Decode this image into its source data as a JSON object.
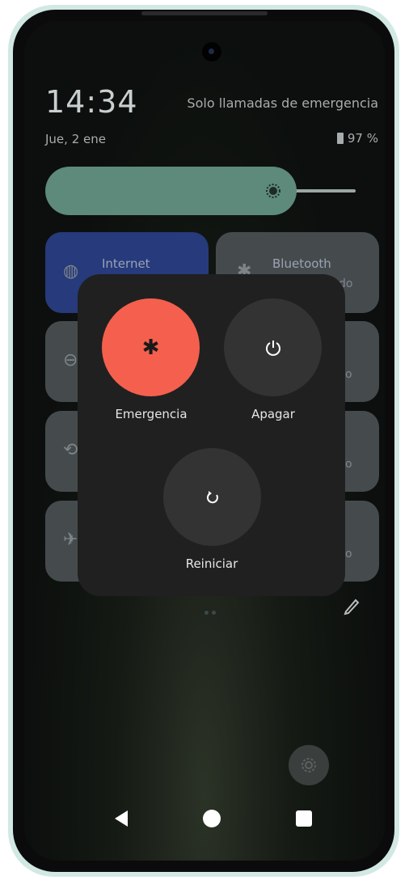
{
  "status": {
    "time": "14:34",
    "carrier": "Solo llamadas de emergencia",
    "date": "Jue, 2 ene",
    "battery": "97 %"
  },
  "quick_settings": {
    "brightness_level": 0.8,
    "tiles": [
      {
        "label": "Internet",
        "sub": ""
      },
      {
        "label": "Bluetooth",
        "sub": "do"
      }
    ],
    "partial_subs": [
      "o",
      "o",
      "o"
    ]
  },
  "power_menu": {
    "emergency_label": "Emergencia",
    "power_off_label": "Apagar",
    "restart_label": "Reiniciar",
    "emergency_glyph": "✱"
  },
  "nav": {
    "back": "back-icon",
    "home": "home-icon",
    "recents": "recents-icon"
  }
}
